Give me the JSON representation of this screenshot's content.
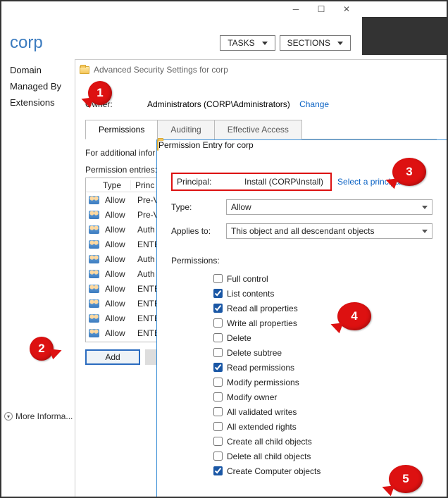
{
  "window_controls": {
    "min": "─",
    "max": "☐",
    "close": "✕"
  },
  "header": {
    "domain_name": "corp",
    "tasks_label": "TASKS",
    "sections_label": "SECTIONS"
  },
  "leftnav": {
    "items": [
      "Domain",
      "Managed By",
      "Extensions"
    ],
    "more_label": "More Informa..."
  },
  "adv": {
    "title": "Advanced Security Settings for corp",
    "owner_label": "Owner:",
    "owner_value": "Administrators (CORP\\Administrators)",
    "change_link": "Change",
    "tabs": [
      "Permissions",
      "Auditing",
      "Effective Access"
    ],
    "subtext": "For additional infor",
    "entries_label": "Permission entries:",
    "col_type": "Type",
    "col_principal": "Princ",
    "rows": [
      {
        "type": "Allow",
        "principal": "Pre-V"
      },
      {
        "type": "Allow",
        "principal": "Pre-V"
      },
      {
        "type": "Allow",
        "principal": "Auth"
      },
      {
        "type": "Allow",
        "principal": "ENTE"
      },
      {
        "type": "Allow",
        "principal": "Auth"
      },
      {
        "type": "Allow",
        "principal": "Auth"
      },
      {
        "type": "Allow",
        "principal": "ENTE"
      },
      {
        "type": "Allow",
        "principal": "ENTE"
      },
      {
        "type": "Allow",
        "principal": "ENTE"
      },
      {
        "type": "Allow",
        "principal": "ENTE"
      }
    ],
    "add_label": "Add"
  },
  "perm": {
    "title": "Permission Entry for corp",
    "principal_label": "Principal:",
    "principal_value": "Install (CORP\\Install)",
    "select_link": "Select a principal",
    "type_label": "Type:",
    "type_value": "Allow",
    "applies_label": "Applies to:",
    "applies_value": "This object and all descendant objects",
    "perms_label": "Permissions:",
    "perms": [
      {
        "label": "Full control",
        "checked": false
      },
      {
        "label": "List contents",
        "checked": true
      },
      {
        "label": "Read all properties",
        "checked": true
      },
      {
        "label": "Write all properties",
        "checked": false
      },
      {
        "label": "Delete",
        "checked": false
      },
      {
        "label": "Delete subtree",
        "checked": false
      },
      {
        "label": "Read permissions",
        "checked": true
      },
      {
        "label": "Modify permissions",
        "checked": false
      },
      {
        "label": "Modify owner",
        "checked": false
      },
      {
        "label": "All validated writes",
        "checked": false
      },
      {
        "label": "All extended rights",
        "checked": false
      },
      {
        "label": "Create all child objects",
        "checked": false
      },
      {
        "label": "Delete all child objects",
        "checked": false
      },
      {
        "label": "Create Computer objects",
        "checked": true
      }
    ]
  },
  "callouts": {
    "c1": "1",
    "c2": "2",
    "c3": "3",
    "c4": "4",
    "c5": "5"
  }
}
